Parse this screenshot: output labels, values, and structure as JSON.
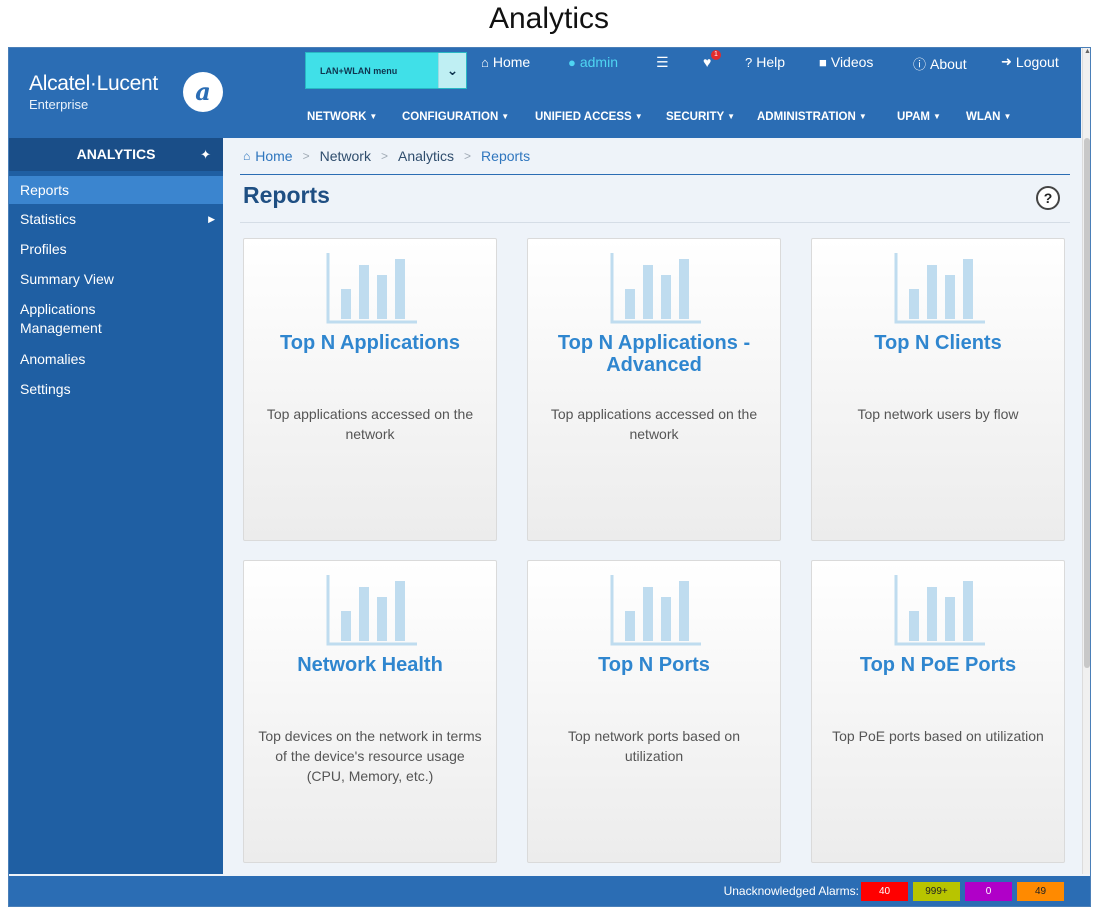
{
  "figure_caption": "Analytics",
  "brand": {
    "name": "Alcatel·Lucent",
    "sub": "Enterprise"
  },
  "menu_select": {
    "value": "LAN+WLAN menu"
  },
  "topnav": {
    "home": "Home",
    "user": "admin",
    "help": "Help",
    "videos": "Videos",
    "about": "About",
    "logout": "Logout",
    "alarm_badge": "1"
  },
  "mainnav": [
    "NETWORK",
    "CONFIGURATION",
    "UNIFIED ACCESS",
    "SECURITY",
    "ADMINISTRATION",
    "UPAM",
    "WLAN"
  ],
  "sidebar": {
    "header": "ANALYTICS",
    "items": [
      {
        "label": "Reports"
      },
      {
        "label": "Statistics"
      },
      {
        "label": "Profiles"
      },
      {
        "label": "Summary View"
      },
      {
        "label": "Applications Management"
      },
      {
        "label": "Anomalies"
      },
      {
        "label": "Settings"
      }
    ]
  },
  "breadcrumb": [
    "Home",
    "Network",
    "Analytics",
    "Reports"
  ],
  "page": {
    "title": "Reports",
    "help": "?"
  },
  "cards": [
    {
      "title": "Top N Applications",
      "desc": "Top applications accessed on the network",
      "icon": "bar-chart-icon"
    },
    {
      "title": "Top N Applications - Advanced",
      "desc": "Top applications accessed on the network",
      "icon": "bar-chart-icon"
    },
    {
      "title": "Top N Clients",
      "desc": "Top network users by flow",
      "icon": "bar-chart-icon"
    },
    {
      "title": "Network Health",
      "desc": "Top devices on the network in terms of the device's resource usage (CPU, Memory, etc.)",
      "icon": "bar-chart-icon"
    },
    {
      "title": "Top N Ports",
      "desc": "Top network ports based on utilization",
      "icon": "bar-chart-icon"
    },
    {
      "title": "Top N PoE Ports",
      "desc": "Top PoE ports based on utilization",
      "icon": "bar-chart-icon"
    }
  ],
  "footer": {
    "alarm_label": "Unacknowledged Alarms:",
    "alarms": [
      {
        "value": "40",
        "color": "#ff0000"
      },
      {
        "value": "999+",
        "color": "#b8c400"
      },
      {
        "value": "0",
        "color": "#b000c8"
      },
      {
        "value": "49",
        "color": "#ff8a00"
      }
    ]
  },
  "colors": {
    "header": "#2b6db4",
    "sidebar": "#1f5fa3",
    "accent": "#2f86cf",
    "icon": "#bfdcef"
  }
}
